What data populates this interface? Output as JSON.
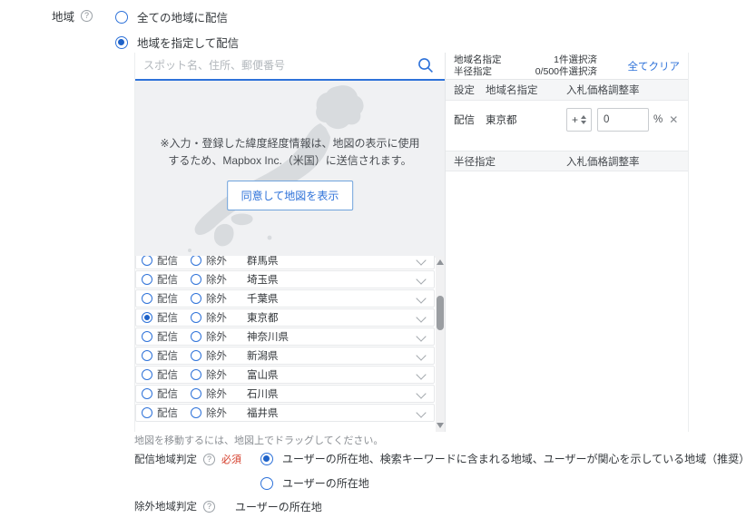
{
  "icons": {
    "help_glyph": "?",
    "close_glyph": "✕"
  },
  "region_field": {
    "label": "地域",
    "options": [
      {
        "label": "全ての地域に配信",
        "selected": false
      },
      {
        "label": "地域を指定して配信",
        "selected": true
      }
    ]
  },
  "search": {
    "placeholder": "スポット名、住所、郵便番号"
  },
  "map": {
    "notice_line1": "※入力・登録した緯度経度情報は、地図の表示に使用",
    "notice_line2": "するため、Mapbox Inc.（米国）に送信されます。",
    "consent_button_label": "同意して地図を表示",
    "drag_hint": "地図を移動するには、地図上でドラッグしてください。"
  },
  "prefecture_list": {
    "deliver_label": "配信",
    "exclude_label": "除外",
    "rows": [
      {
        "name": "群馬県",
        "state": "none"
      },
      {
        "name": "埼玉県",
        "state": "none"
      },
      {
        "name": "千葉県",
        "state": "none"
      },
      {
        "name": "東京都",
        "state": "deliver"
      },
      {
        "name": "神奈川県",
        "state": "none"
      },
      {
        "name": "新潟県",
        "state": "none"
      },
      {
        "name": "富山県",
        "state": "none"
      },
      {
        "name": "石川県",
        "state": "none"
      },
      {
        "name": "福井県",
        "state": "none"
      }
    ]
  },
  "selection_panel": {
    "summary": {
      "area_label": "地域名指定",
      "area_count": "1件選択済",
      "radius_label": "半径指定",
      "radius_count": "0/500件選択済",
      "clear_all_label": "全てクリア"
    },
    "area_table": {
      "col_setting": "設定",
      "col_area": "地域名指定",
      "col_bid": "入札価格調整率",
      "rows": [
        {
          "setting": "配信",
          "area": "東京都",
          "sign": "+",
          "value": "0",
          "unit": "%"
        }
      ]
    },
    "radius_table": {
      "col_radius": "半径指定",
      "col_bid": "入札価格調整率"
    }
  },
  "delivery_area_judgement": {
    "label": "配信地域判定",
    "required_badge": "必須",
    "options": [
      {
        "label": "ユーザーの所在地、検索キーワードに含まれる地域、ユーザーが関心を示している地域（推奨）",
        "selected": true
      },
      {
        "label": "ユーザーの所在地",
        "selected": false
      }
    ]
  },
  "exclusion_area_judgement": {
    "label": "除外地域判定",
    "value": "ユーザーの所在地"
  },
  "colors": {
    "accent_blue": "#2e72d9",
    "required_red": "#d43a27",
    "map_bg": "#f0f1f3",
    "map_land": "#d8dbde"
  }
}
